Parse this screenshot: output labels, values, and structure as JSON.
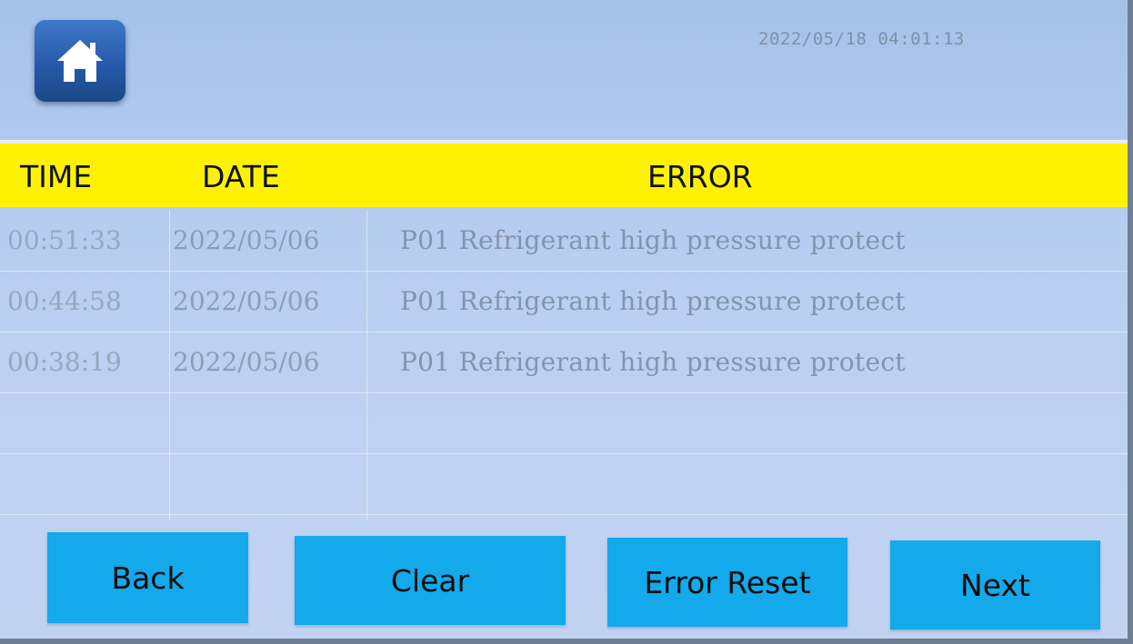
{
  "header": {
    "home_icon": "home-icon",
    "datetime": "2022/05/18 04:01:13"
  },
  "table": {
    "columns": {
      "time": "TIME",
      "date": "DATE",
      "error": "ERROR"
    },
    "rows": [
      {
        "time": "00:51:33",
        "date": "2022/05/06",
        "error": "P01 Refrigerant high pressure protect"
      },
      {
        "time": "00:44:58",
        "date": "2022/05/06",
        "error": "P01 Refrigerant high pressure protect"
      },
      {
        "time": "00:38:19",
        "date": "2022/05/06",
        "error": "P01 Refrigerant high pressure protect"
      }
    ]
  },
  "buttons": {
    "back": "Back",
    "clear": "Clear",
    "error_reset": "Error Reset",
    "next": "Next"
  },
  "colors": {
    "screen_bg": "#b2cbef",
    "header_bar": "#fff200",
    "button_bg": "#13a9ea",
    "home_button": "#2458a6"
  }
}
